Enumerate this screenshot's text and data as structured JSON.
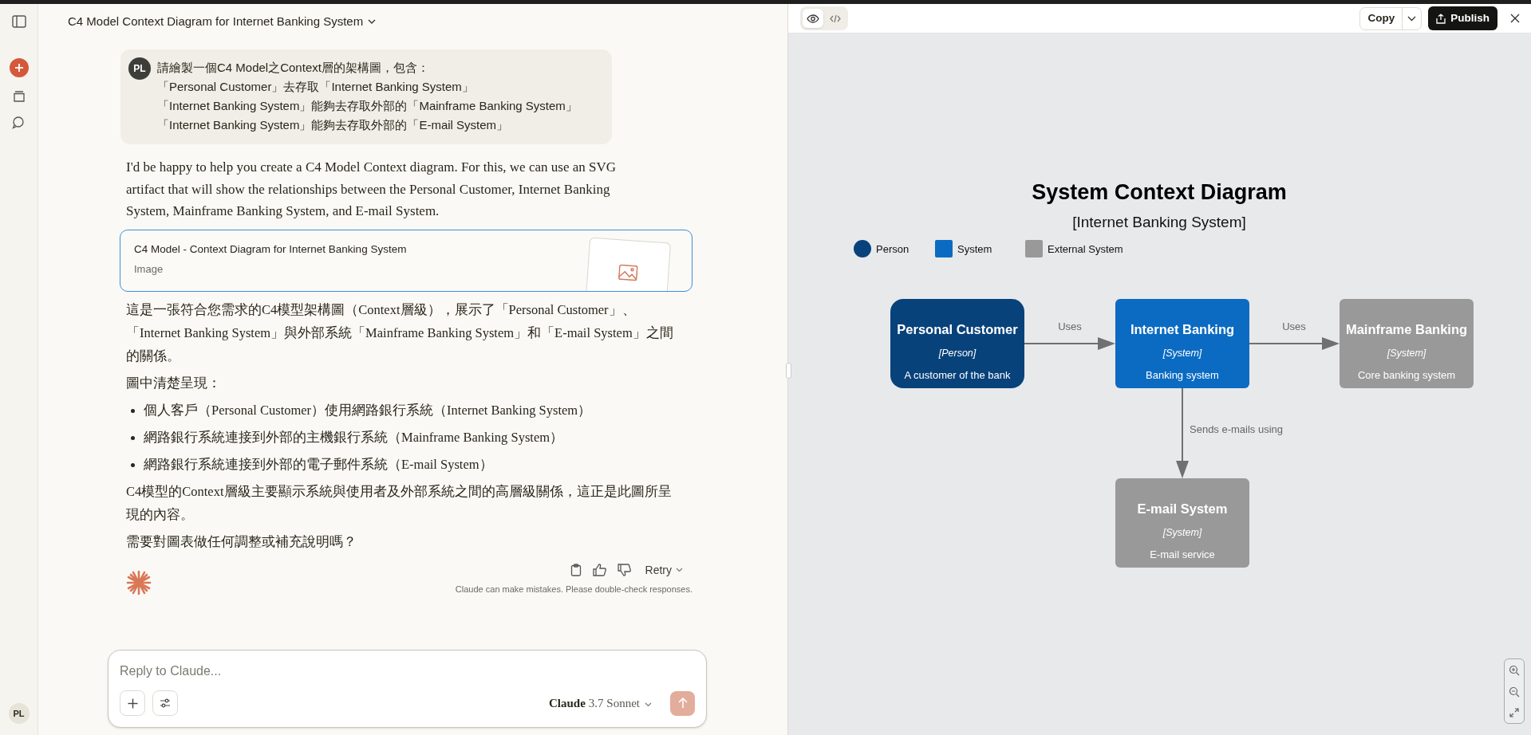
{
  "sidebar": {
    "avatar": "PL"
  },
  "header": {
    "title": "C4 Model Context Diagram for Internet Banking System"
  },
  "user_message": {
    "avatar": "PL",
    "lines": [
      "請繪製一個C4 Model之Context層的架構圖，包含：",
      "「Personal Customer」去存取「Internet Banking System」",
      "「Internet Banking System」能夠去存取外部的「Mainframe Banking System」",
      "「Internet Banking System」能夠去存取外部的「E-mail System」"
    ]
  },
  "assistant": {
    "intro": "I'd be happy to help you create a C4 Model Context diagram. For this, we can use an SVG artifact that will show the relationships between the Personal Customer, Internet Banking System, Mainframe Banking System, and E-mail System.",
    "artifact": {
      "title": "C4 Model - Context Diagram for Internet Banking System",
      "type": "Image"
    },
    "blocks": [
      {
        "kind": "paragraph",
        "text": "這是一張符合您需求的C4模型架構圖（Context層級），展示了「Personal Customer」、「Internet Banking System」與外部系統「Mainframe Banking System」和「E-mail System」之間的關係。"
      },
      {
        "kind": "paragraph",
        "text": "圖中清楚呈現："
      },
      {
        "kind": "bullets",
        "items": [
          "個人客戶（Personal Customer）使用網路銀行系統（Internet Banking System）",
          "網路銀行系統連接到外部的主機銀行系統（Mainframe Banking System）",
          "網路銀行系統連接到外部的電子郵件系統（E-mail System）"
        ]
      },
      {
        "kind": "paragraph",
        "text": "C4模型的Context層級主要顯示系統與使用者及外部系統之間的高層級關係，這正是此圖所呈現的內容。"
      },
      {
        "kind": "paragraph",
        "text": "需要對圖表做任何調整或補充說明嗎？"
      }
    ],
    "retry": "Retry",
    "disclaimer": "Claude can make mistakes. Please double-check responses."
  },
  "composer": {
    "placeholder": "Reply to Claude...",
    "model_name": "Claude",
    "model_version": "3.7 Sonnet"
  },
  "artifact_panel": {
    "view_tabs": [
      {
        "kind": "preview",
        "selected": true
      },
      {
        "kind": "code",
        "selected": false
      }
    ],
    "copy": "Copy",
    "publish": "Publish"
  },
  "diagram": {
    "title": "System Context Diagram",
    "subtitle": "[Internet Banking System]",
    "legend": [
      {
        "label": "Person",
        "kind": "circle",
        "color": "#08427b"
      },
      {
        "label": "System",
        "kind": "square",
        "color": "#0b6bc2"
      },
      {
        "label": "External System",
        "kind": "square",
        "color": "#999999"
      }
    ],
    "nodes": [
      {
        "name": "Personal Customer",
        "type": "[Person]",
        "description": "A customer of the bank",
        "color": "#08427b"
      },
      {
        "name": "Internet Banking",
        "type": "[System]",
        "description": "Banking system",
        "color": "#0b6bc2"
      },
      {
        "name": "Mainframe Banking",
        "type": "[System]",
        "description": "Core banking system",
        "color": "#999999"
      },
      {
        "name": "E-mail System",
        "type": "[System]",
        "description": "E-mail service",
        "color": "#999999"
      }
    ],
    "edges": [
      {
        "label": "Uses"
      },
      {
        "label": "Uses"
      },
      {
        "label": "Sends e-mails using"
      }
    ]
  }
}
